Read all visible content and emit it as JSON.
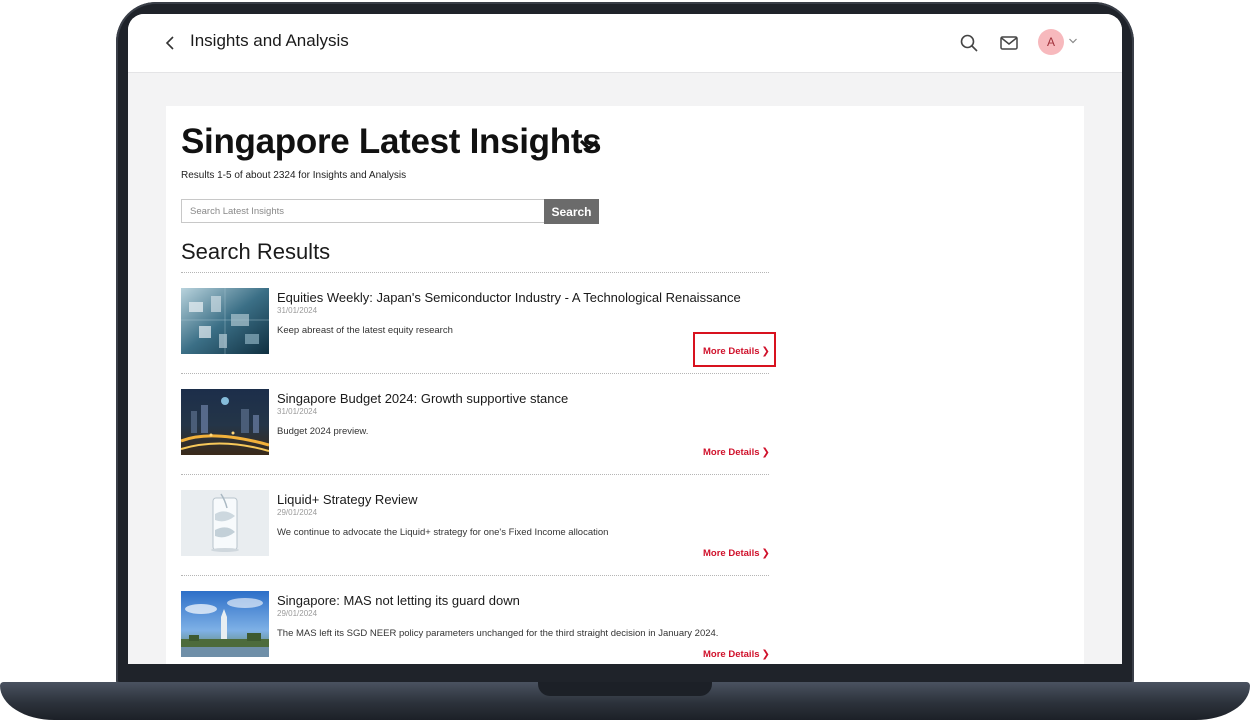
{
  "header": {
    "title": "Insights and Analysis",
    "avatar_initial": "A"
  },
  "main": {
    "page_title": "Singapore Latest Insights",
    "results_summary": "Results 1-5 of about 2324 for Insights and Analysis",
    "search": {
      "placeholder": "Search Latest Insights",
      "button_label": "Search"
    },
    "section_title": "Search Results",
    "more_label": "More Details",
    "results": [
      {
        "title": "Equities Weekly: Japan's Semiconductor Industry - A Technological Renaissance",
        "date": "31/01/2024",
        "description": "Keep abreast of the latest equity research"
      },
      {
        "title": "Singapore Budget 2024: Growth supportive stance",
        "date": "31/01/2024",
        "description": "Budget 2024 preview."
      },
      {
        "title": "Liquid+ Strategy Review",
        "date": "29/01/2024",
        "description": "We continue to advocate the Liquid+ strategy for one's Fixed Income allocation"
      },
      {
        "title": "Singapore: MAS not letting its guard down",
        "date": "29/01/2024",
        "description": "The MAS left its SGD NEER policy parameters unchanged for the third straight decision in January 2024."
      }
    ]
  },
  "colors": {
    "accent_red": "#d0112b",
    "highlight_border": "#d8121f",
    "search_button": "#6b6b6b"
  }
}
